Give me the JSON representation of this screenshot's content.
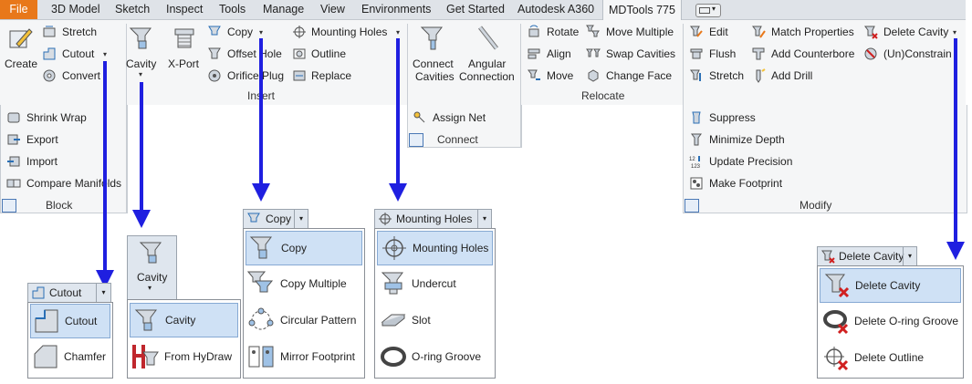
{
  "tabs": [
    "File",
    "3D Model",
    "Sketch",
    "Inspect",
    "Tools",
    "Manage",
    "View",
    "Environments",
    "Get Started",
    "Autodesk A360",
    "MDTools 775"
  ],
  "ribbon": {
    "create": {
      "label": "Create",
      "stretch": "Stretch",
      "cutout": "Cutout",
      "convert": "Convert"
    },
    "block": {
      "shrink_wrap": "Shrink Wrap",
      "export": "Export",
      "import": "Import",
      "compare": "Compare Manifolds",
      "panel": "Block"
    },
    "insert": {
      "cavity": "Cavity",
      "xport": "X-Port",
      "copy": "Copy",
      "offset_hole": "Offset Hole",
      "orifice_plug": "Orifice Plug",
      "mounting_holes": "Mounting Holes",
      "outline": "Outline",
      "replace": "Replace",
      "panel": "Insert"
    },
    "connect": {
      "connect_cavities_1": "Connect",
      "connect_cavities_2": "Cavities",
      "angular_1": "Angular",
      "angular_2": "Connection",
      "assign_net": "Assign Net",
      "panel": "Connect"
    },
    "relocate": {
      "rotate": "Rotate",
      "align": "Align",
      "move": "Move",
      "move_multiple": "Move Multiple",
      "swap_cavities": "Swap Cavities",
      "change_face": "Change Face",
      "panel": "Relocate"
    },
    "modify": {
      "edit": "Edit",
      "flush": "Flush",
      "stretch": "Stretch",
      "match_properties": "Match Properties",
      "add_counterbore": "Add Counterbore",
      "add_drill": "Add Drill",
      "delete_cavity": "Delete Cavity",
      "unconstrain": "(Un)Constrain",
      "suppress": "Suppress",
      "minimize_depth": "Minimize Depth",
      "update_precision": "Update Precision",
      "make_footprint": "Make Footprint",
      "panel": "Modify"
    }
  },
  "menus": {
    "cutout": {
      "header": "Cutout",
      "items": [
        "Cutout",
        "Chamfer"
      ]
    },
    "cavity": {
      "header": "Cavity",
      "items": [
        "Cavity",
        "From HyDraw"
      ]
    },
    "copy": {
      "header": "Copy",
      "items": [
        "Copy",
        "Copy Multiple",
        "Circular Pattern",
        "Mirror Footprint"
      ]
    },
    "mounting": {
      "header": "Mounting Holes",
      "items": [
        "Mounting Holes",
        "Undercut",
        "Slot",
        "O-ring Groove"
      ]
    },
    "delete": {
      "header": "Delete Cavity",
      "items": [
        "Delete Cavity",
        "Delete O-ring Groove",
        "Delete Outline"
      ]
    }
  },
  "colors": {
    "file_tab": "#e8781a",
    "arrow": "#1f1fe0",
    "highlight": "#cfe1f5"
  }
}
